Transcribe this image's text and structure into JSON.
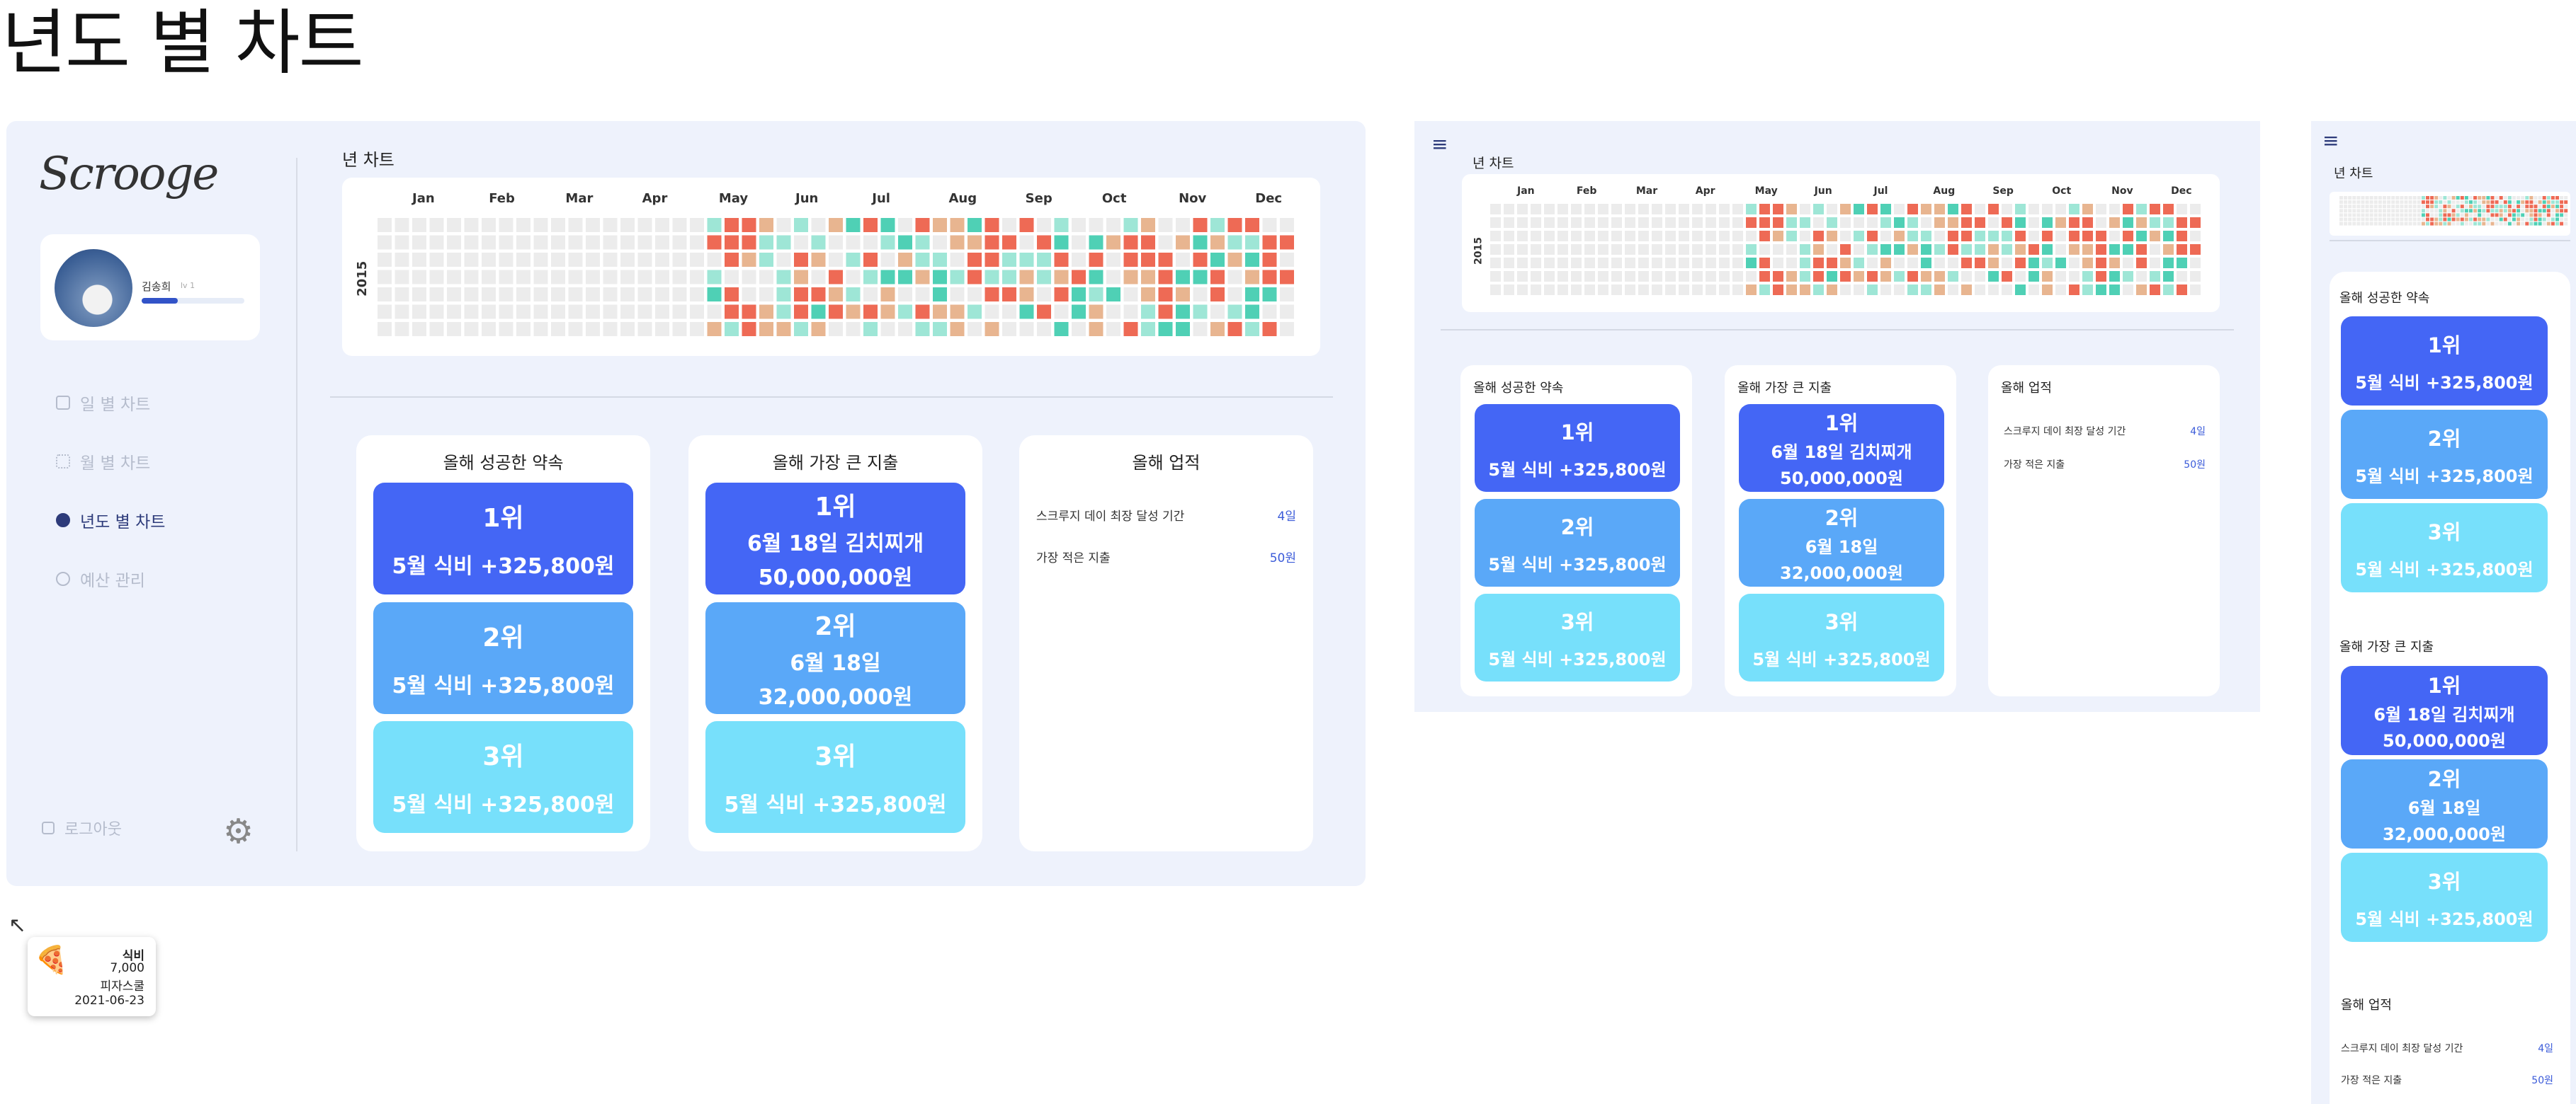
{
  "page_title": "년도 별 차트",
  "logo": "Scrooge",
  "user": {
    "name": "김송희",
    "level": "lv 1"
  },
  "nav": [
    {
      "label": "일 별 차트",
      "icon": "document-icon"
    },
    {
      "label": "월 별 차트",
      "icon": "grid-icon"
    },
    {
      "label": "년도 별 차트",
      "icon": "globe-icon"
    },
    {
      "label": "예산 관리",
      "icon": "clock-icon"
    }
  ],
  "logout_label": "로그아웃",
  "chart_title": "년 차트",
  "year_label": "2015",
  "months": [
    "Jan",
    "Feb",
    "Mar",
    "Apr",
    "May",
    "Jun",
    "Jul",
    "Aug",
    "Sep",
    "Oct",
    "Nov",
    "Dec"
  ],
  "promises": {
    "title": "올해 성공한 약속",
    "items": [
      {
        "rank": "1위",
        "text": "5월 식비 +325,800원"
      },
      {
        "rank": "2위",
        "text": "5월 식비 +325,800원"
      },
      {
        "rank": "3위",
        "text": "5월 식비 +325,800원"
      }
    ]
  },
  "expenses": {
    "title": "올해 가장 큰 지출",
    "items": [
      {
        "rank": "1위",
        "line1": "6월 18일 김치찌개",
        "line2": "50,000,000원"
      },
      {
        "rank": "2위",
        "line1": "6월 18일",
        "line2": "32,000,000원"
      },
      {
        "rank": "3위",
        "line1": "5월 식비 +325,800원",
        "line2": ""
      }
    ]
  },
  "achievements": {
    "title": "올해 업적",
    "items": [
      {
        "label": "스크루지 데이 최장 달성 기간",
        "value": "4일"
      },
      {
        "label": "가장 적은 지출",
        "value": "50원"
      }
    ]
  },
  "tooltip": {
    "category": "식비",
    "amount": "7,000",
    "place": "피자스쿨",
    "date": "2021-06-23",
    "icon": "pizza-icon"
  },
  "colors": {
    "empty": "#ececec",
    "green": "#4fd0b5",
    "red": "#ee6a55",
    "peach": "#e8b590",
    "light_green": "#9ee6d6",
    "blue1": "#4466f5",
    "blue2": "#5aa8f8",
    "blue3": "#77e0fb"
  }
}
